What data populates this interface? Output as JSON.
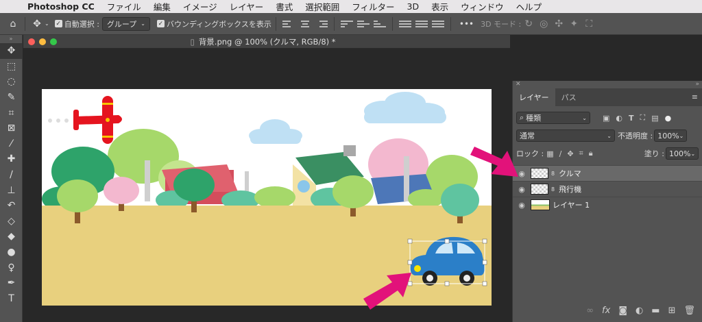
{
  "menubar": {
    "app_name": "Photoshop CC",
    "items": [
      "ファイル",
      "編集",
      "イメージ",
      "レイヤー",
      "書式",
      "選択範囲",
      "フィルター",
      "3D",
      "表示",
      "ウィンドウ",
      "ヘルプ"
    ]
  },
  "options": {
    "auto_select_label": "自動選択 :",
    "auto_select_value": "グループ",
    "bounding_box_label": "バウンディングボックスを表示",
    "mode_3d_label": "3D モード :",
    "more": "•••"
  },
  "document": {
    "title": "背景.png @ 100% (クルマ, RGB/8) *"
  },
  "layers_panel": {
    "tabs": [
      "レイヤー",
      "パス"
    ],
    "filter_label": "種類",
    "blend_mode": "通常",
    "opacity_label": "不透明度 :",
    "opacity_value": "100%",
    "lock_label": "ロック :",
    "fill_label": "塗り :",
    "fill_value": "100%",
    "layers": [
      {
        "name": "クルマ",
        "selected": true
      },
      {
        "name": "飛行機",
        "selected": false
      },
      {
        "name": "レイヤー 1",
        "selected": false
      }
    ],
    "footer_icons": [
      "link-icon",
      "fx-icon",
      "mask-icon",
      "adjustment-icon",
      "folder-icon",
      "new-layer-icon",
      "trash-icon"
    ]
  },
  "colors": {
    "accent_arrow": "#e2127a",
    "car": "#2b7fc8",
    "plane": "#e5141f",
    "ground": "#e8d07e"
  }
}
